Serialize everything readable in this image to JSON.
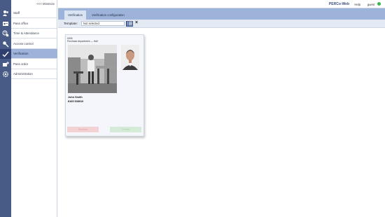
{
  "app": {
    "brand": "PERCo-Web",
    "help_label": "Help",
    "user_label": "guest",
    "status_color": "#3bb84a"
  },
  "sidebar": {
    "minimize_label": "<<< Minimize",
    "items": [
      {
        "label": "Staff",
        "icon": "staff-icon"
      },
      {
        "label": "Pass office",
        "icon": "id-card-icon"
      },
      {
        "label": "Time & Attendance",
        "icon": "clock-person-icon"
      },
      {
        "label": "Access control",
        "icon": "key-icon"
      },
      {
        "label": "Verification",
        "icon": "verification-icon",
        "active": true
      },
      {
        "label": "Pass order",
        "icon": "pass-order-icon"
      },
      {
        "label": "Administration",
        "icon": "gear-icon"
      }
    ]
  },
  "tabs": [
    {
      "label": "Verification",
      "active": true
    },
    {
      "label": "Verification configuration",
      "active": false
    }
  ],
  "toolbar": {
    "template_label": "Template:",
    "template_value": "Not selected",
    "clear_symbol": "×"
  },
  "card": {
    "id_line": "0005",
    "department_line": "Purchase department — Hall",
    "name": "John Smith",
    "number": "8165 538910",
    "deny_label": "Disallow",
    "allow_label": "Permit"
  },
  "colors": {
    "rail": "#485a86",
    "active_item": "#9db3d9",
    "tab_bar": "#9db3d9"
  }
}
